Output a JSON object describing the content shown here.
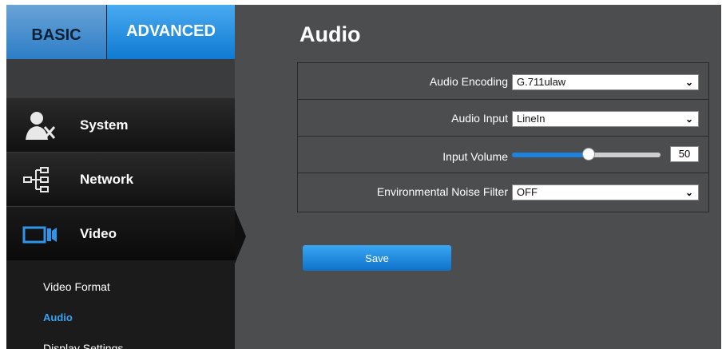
{
  "tabs": {
    "basic": "BASIC",
    "advanced": "ADVANCED",
    "active": "ADVANCED"
  },
  "nav": [
    {
      "label": "System",
      "icon": "system-user-tools-icon"
    },
    {
      "label": "Network",
      "icon": "network-tree-icon"
    },
    {
      "label": "Video",
      "icon": "video-camera-icon"
    }
  ],
  "video_subitems": [
    {
      "label": "Video Format",
      "active": false
    },
    {
      "label": "Audio",
      "active": true
    },
    {
      "label": "Display Settings",
      "active": false
    }
  ],
  "page": {
    "title": "Audio"
  },
  "form": {
    "audio_encoding": {
      "label": "Audio Encoding",
      "value": "G.711ulaw"
    },
    "audio_input": {
      "label": "Audio Input",
      "value": "LineIn"
    },
    "input_volume": {
      "label": "Input Volume",
      "value": "50"
    },
    "noise_filter": {
      "label": "Environmental Noise Filter",
      "value": "OFF"
    }
  },
  "save_label": "Save",
  "colors": {
    "accent": "#1e83de",
    "panel": "#4c4d4f",
    "sidebar": "#1b1b1b",
    "active_sub": "#3aa2f0"
  }
}
